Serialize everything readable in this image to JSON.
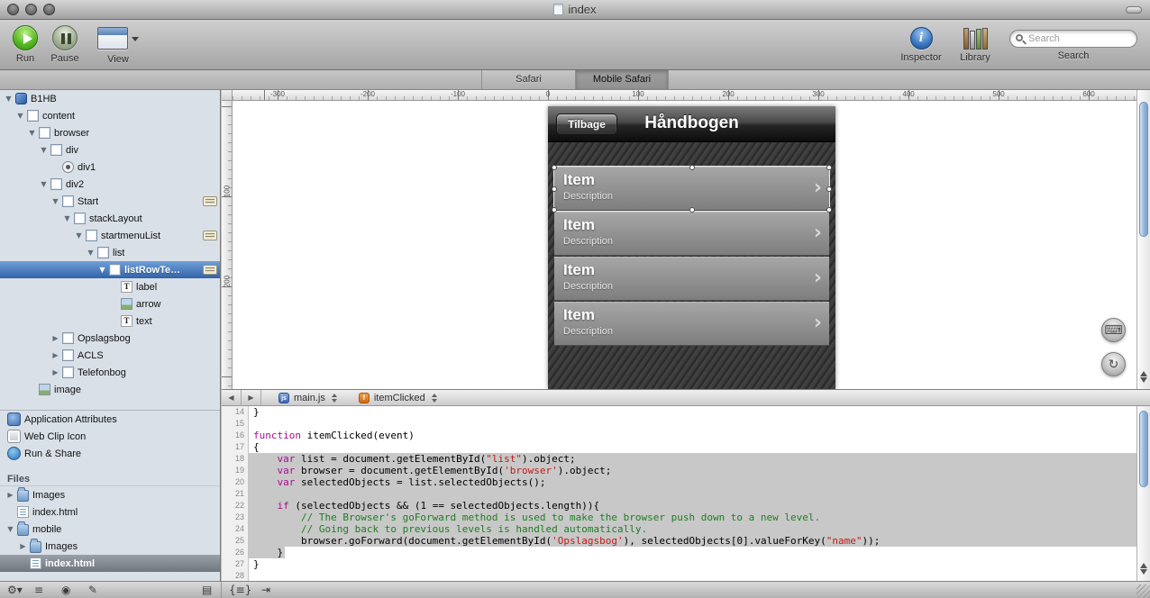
{
  "window": {
    "title": "index"
  },
  "toolbar": {
    "run_label": "Run",
    "pause_label": "Pause",
    "view_label": "View",
    "inspector_label": "Inspector",
    "library_label": "Library",
    "search_label": "Search",
    "search_placeholder": "Search"
  },
  "mode_tabs": [
    {
      "label": "Safari",
      "active": false
    },
    {
      "label": "Mobile Safari",
      "active": true
    }
  ],
  "sidebar": {
    "tree": [
      {
        "label": "B1HB",
        "depth": 0,
        "disclosure": "open",
        "icon": "project"
      },
      {
        "label": "content",
        "depth": 1,
        "disclosure": "open",
        "icon": "box"
      },
      {
        "label": "browser",
        "depth": 2,
        "disclosure": "open",
        "icon": "box"
      },
      {
        "label": "div",
        "depth": 3,
        "disclosure": "open",
        "icon": "box"
      },
      {
        "label": "div1",
        "depth": 4,
        "disclosure": "none",
        "icon": "dot"
      },
      {
        "label": "div2",
        "depth": 3,
        "disclosure": "open",
        "icon": "box"
      },
      {
        "label": "Start",
        "depth": 4,
        "disclosure": "open",
        "icon": "box",
        "badge": true
      },
      {
        "label": "stackLayout",
        "depth": 5,
        "disclosure": "open",
        "icon": "box"
      },
      {
        "label": "startmenuList",
        "depth": 6,
        "disclosure": "open",
        "icon": "box",
        "badge": true
      },
      {
        "label": "list",
        "depth": 7,
        "disclosure": "open",
        "icon": "box"
      },
      {
        "label": "listRowTe…",
        "depth": 8,
        "disclosure": "open",
        "icon": "box",
        "selected": true,
        "badge": true
      },
      {
        "label": "label",
        "depth": 9,
        "disclosure": "none",
        "icon": "text"
      },
      {
        "label": "arrow",
        "depth": 9,
        "disclosure": "none",
        "icon": "image"
      },
      {
        "label": "text",
        "depth": 9,
        "disclosure": "none",
        "icon": "text"
      },
      {
        "label": "Opslagsbog",
        "depth": 4,
        "disclosure": "closed",
        "icon": "box"
      },
      {
        "label": "ACLS",
        "depth": 4,
        "disclosure": "closed",
        "icon": "box"
      },
      {
        "label": "Telefonbog",
        "depth": 4,
        "disclosure": "closed",
        "icon": "box"
      },
      {
        "label": "image",
        "depth": 2,
        "disclosure": "none",
        "icon": "image"
      }
    ],
    "sections": [
      {
        "label": "Application Attributes",
        "icon": "attributes"
      },
      {
        "label": "Web Clip Icon",
        "icon": "webclip"
      },
      {
        "label": "Run & Share",
        "icon": "share"
      }
    ],
    "files_header": "Files",
    "files": [
      {
        "label": "Images",
        "depth": 0,
        "disclosure": "closed",
        "icon": "folder"
      },
      {
        "label": "index.html",
        "depth": 0,
        "disclosure": "none",
        "icon": "html"
      },
      {
        "label": "mobile",
        "depth": 0,
        "disclosure": "open",
        "icon": "folder"
      },
      {
        "label": "Images",
        "depth": 1,
        "disclosure": "closed",
        "icon": "folder"
      },
      {
        "label": "index.html",
        "depth": 1,
        "disclosure": "none",
        "icon": "html",
        "selected": true
      }
    ]
  },
  "canvas": {
    "h_ruler_labels": [
      "-300",
      "-200",
      "-100",
      "0",
      "100",
      "200",
      "300",
      "400",
      "500",
      "600"
    ],
    "v_ruler_labels": [
      "100",
      "200"
    ],
    "float_buttons": [
      {
        "name": "keyboard-button",
        "glyph": "⌨"
      },
      {
        "name": "rotate-button",
        "glyph": "↻"
      }
    ],
    "phone": {
      "back_button": "Tilbage",
      "title": "Håndbogen",
      "items": [
        {
          "title": "Item",
          "description": "Description"
        },
        {
          "title": "Item",
          "description": "Description"
        },
        {
          "title": "Item",
          "description": "Description"
        },
        {
          "title": "Item",
          "description": "Description"
        }
      ]
    }
  },
  "editor": {
    "back_glyph": "◀",
    "forward_glyph": "▶",
    "file_popup": {
      "icon_text": "js",
      "label": "main.js"
    },
    "function_popup": {
      "icon_text": "f",
      "label": "itemClicked"
    },
    "lines": [
      {
        "n": 14,
        "sel": "none",
        "seg": [
          [
            "}",
            "p"
          ]
        ]
      },
      {
        "n": 15,
        "sel": "none",
        "seg": []
      },
      {
        "n": 16,
        "sel": "none",
        "seg": [
          [
            "function",
            "k"
          ],
          [
            " itemClicked(event)",
            "p"
          ]
        ]
      },
      {
        "n": 17,
        "sel": "none",
        "seg": [
          [
            "{",
            "p"
          ]
        ]
      },
      {
        "n": 18,
        "sel": "full",
        "seg": [
          [
            "    ",
            "p"
          ],
          [
            "var",
            "k"
          ],
          [
            " list = document.getElementById(",
            "p"
          ],
          [
            "\"list\"",
            "s"
          ],
          [
            ").object;",
            "p"
          ]
        ]
      },
      {
        "n": 19,
        "sel": "full",
        "seg": [
          [
            "    ",
            "p"
          ],
          [
            "var",
            "k"
          ],
          [
            " browser = document.getElementById(",
            "p"
          ],
          [
            "'browser'",
            "s"
          ],
          [
            ").object;",
            "p"
          ]
        ]
      },
      {
        "n": 20,
        "sel": "full",
        "seg": [
          [
            "    ",
            "p"
          ],
          [
            "var",
            "k"
          ],
          [
            " selectedObjects = list.selectedObjects();",
            "p"
          ]
        ]
      },
      {
        "n": 21,
        "sel": "full",
        "seg": []
      },
      {
        "n": 22,
        "sel": "full",
        "seg": [
          [
            "    ",
            "p"
          ],
          [
            "if",
            "k"
          ],
          [
            " (selectedObjects && (1 == selectedObjects.length)){",
            "p"
          ]
        ]
      },
      {
        "n": 23,
        "sel": "full",
        "seg": [
          [
            "        ",
            "p"
          ],
          [
            "// The Browser's goForward method is used to make the browser push down to a new level.",
            "c"
          ]
        ]
      },
      {
        "n": 24,
        "sel": "full",
        "seg": [
          [
            "        ",
            "p"
          ],
          [
            "// Going back to previous levels is handled automatically.",
            "c"
          ]
        ]
      },
      {
        "n": 25,
        "sel": "full",
        "seg": [
          [
            "        browser.goForward(document.getElementById(",
            "p"
          ],
          [
            "'Opslagsbog'",
            "s"
          ],
          [
            "), selectedObjects[0].valueForKey(",
            "p"
          ],
          [
            "\"name\"",
            "s"
          ],
          [
            "));",
            "p"
          ]
        ]
      },
      {
        "n": 26,
        "sel": "text",
        "seg": [
          [
            "    }",
            "p"
          ]
        ]
      },
      {
        "n": 27,
        "sel": "none",
        "seg": [
          [
            "}",
            "p"
          ]
        ]
      },
      {
        "n": 28,
        "sel": "none",
        "seg": []
      }
    ]
  },
  "statusbar": {
    "left_icons": [
      {
        "name": "action-menu-icon",
        "glyph": "⚙▾"
      },
      {
        "name": "list-view-icon",
        "glyph": "≡"
      },
      {
        "name": "record-icon",
        "glyph": "◉"
      },
      {
        "name": "edit-icon",
        "glyph": "✎"
      }
    ],
    "sidebar_toggle_icon": {
      "name": "panel-toggle-icon",
      "glyph": "▤"
    },
    "editor_icons": [
      {
        "name": "code-folding-icon",
        "glyph": "{≡}"
      },
      {
        "name": "shift-right-icon",
        "glyph": "⇥"
      }
    ]
  }
}
